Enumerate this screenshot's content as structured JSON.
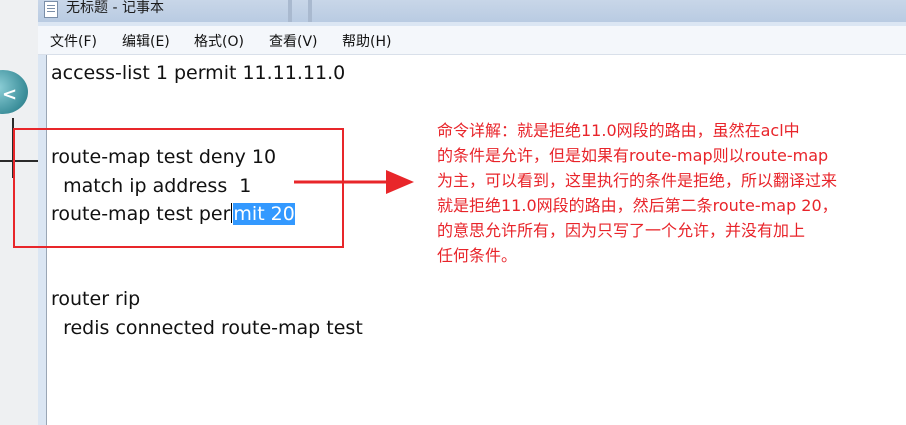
{
  "window": {
    "title": "无标题 - 记事本"
  },
  "menu": {
    "items": [
      {
        "label": "文件(F)"
      },
      {
        "label": "编辑(E)"
      },
      {
        "label": "格式(O)"
      },
      {
        "label": "查看(V)"
      },
      {
        "label": "帮助(H)"
      }
    ]
  },
  "editor": {
    "lines": [
      "access-list 1 permit 11.11.11.0",
      "route-map test deny 10",
      "  match ip address  1",
      "route-map test per",
      "router rip",
      "  redis connected route-map test"
    ],
    "selected_text": "mit 20",
    "selection_color": "#3399ff"
  },
  "annotation": {
    "color": "#e8262a",
    "note_lines": [
      "命令详解：就是拒绝11.0网段的路由，虽然在acl中",
      "的条件是允许，但是如果有route-map则以route-map",
      "为主，可以看到，这里执行的条件是拒绝，所以翻译过来",
      "就是拒绝11.0网段的路由，然后第二条route-map  20，",
      "的意思允许所有，因为只写了一个允许，并没有加上",
      "任何条件。"
    ]
  },
  "icons": {
    "app_icon": "notepad-icon",
    "desktop_device": "router-icon"
  }
}
